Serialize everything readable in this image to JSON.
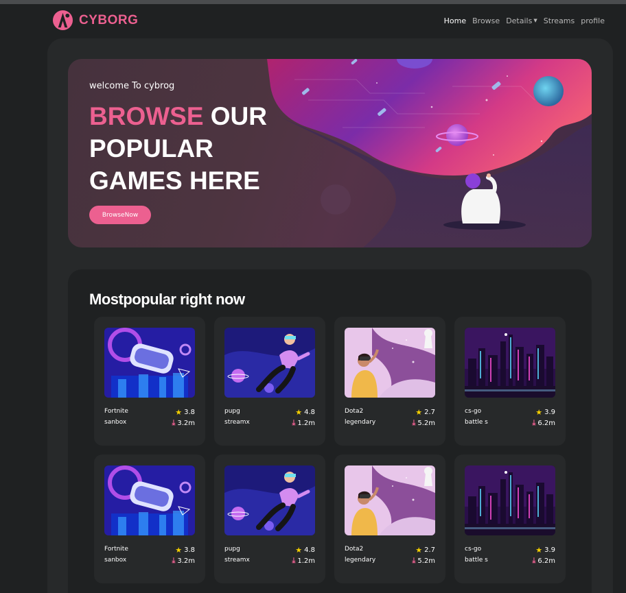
{
  "brand": {
    "name": "CYBORG",
    "accent": "#ec6090"
  },
  "nav": {
    "items": [
      {
        "label": "Home",
        "active": true
      },
      {
        "label": "Browse",
        "active": false
      },
      {
        "label": "Details",
        "active": false,
        "dropdown": true
      },
      {
        "label": "Streams",
        "active": false
      },
      {
        "label": "profile",
        "active": false
      }
    ]
  },
  "hero": {
    "welcome": "welcome To cybrog",
    "title_highlight": "BROWSE",
    "title_rest_1": "OUR",
    "title_line_2": "POPULAR",
    "title_line_3": "GAMES HERE",
    "button_label": "BrowseNow"
  },
  "popular": {
    "title": "Mostpopular right now",
    "cards": [
      {
        "name": "Fortnite",
        "category": "sanbox",
        "rating": "3.8",
        "downloads": "3.2m",
        "image": "vr-headset"
      },
      {
        "name": "pupg",
        "category": "streamx",
        "rating": "4.8",
        "downloads": "1.2m",
        "image": "vr-floating-person"
      },
      {
        "name": "Dota2",
        "category": "legendary",
        "rating": "2.7",
        "downloads": "5.2m",
        "image": "vr-woman-astronaut"
      },
      {
        "name": "cs-go",
        "category": "battle s",
        "rating": "3.9",
        "downloads": "6.2m",
        "image": "neon-city"
      },
      {
        "name": "Fortnite",
        "category": "sanbox",
        "rating": "3.8",
        "downloads": "3.2m",
        "image": "vr-headset"
      },
      {
        "name": "pupg",
        "category": "streamx",
        "rating": "4.8",
        "downloads": "1.2m",
        "image": "vr-floating-person"
      },
      {
        "name": "Dota2",
        "category": "legendary",
        "rating": "2.7",
        "downloads": "5.2m",
        "image": "vr-woman-astronaut"
      },
      {
        "name": "cs-go",
        "category": "battle s",
        "rating": "3.9",
        "downloads": "6.2m",
        "image": "neon-city"
      }
    ]
  }
}
